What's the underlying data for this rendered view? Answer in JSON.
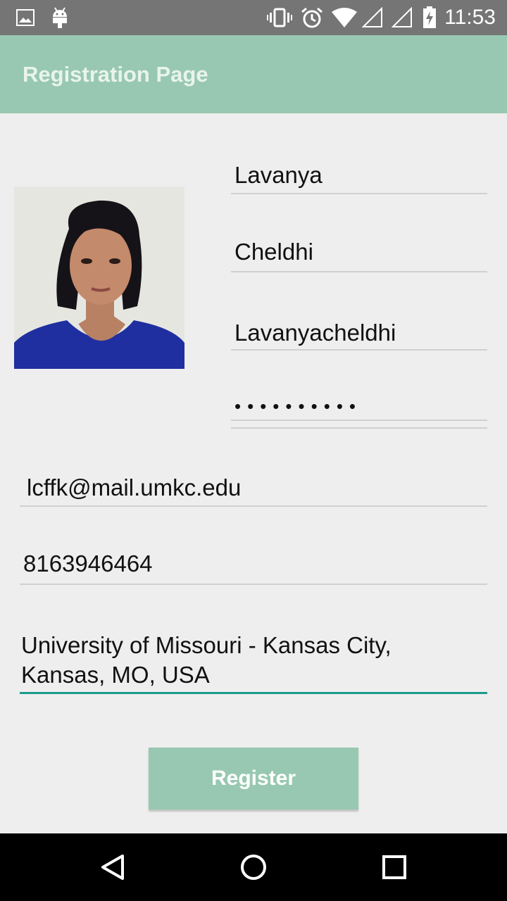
{
  "status_bar": {
    "time": "11:53",
    "icons": [
      "image-icon",
      "android-icon",
      "vibrate-icon",
      "alarm-icon",
      "wifi-icon",
      "signal-icon",
      "signal-icon",
      "battery-charging-icon"
    ]
  },
  "app_bar": {
    "title": "Registration Page"
  },
  "form": {
    "first_name": "Lavanya",
    "last_name": "Cheldhi",
    "username": "Lavanyacheldhi",
    "password_mask": "••••••••••",
    "email": "lcffk@mail.umkc.edu",
    "phone": "8163946464",
    "address": "University of Missouri - Kansas City, Kansas, MO, USA",
    "register_label": "Register"
  },
  "nav_bar": {
    "icons": [
      "back-icon",
      "home-icon",
      "recents-icon"
    ]
  },
  "colors": {
    "accent": "#98c8b1",
    "focus_line": "#1c9a8c",
    "status_bar": "#757575"
  }
}
